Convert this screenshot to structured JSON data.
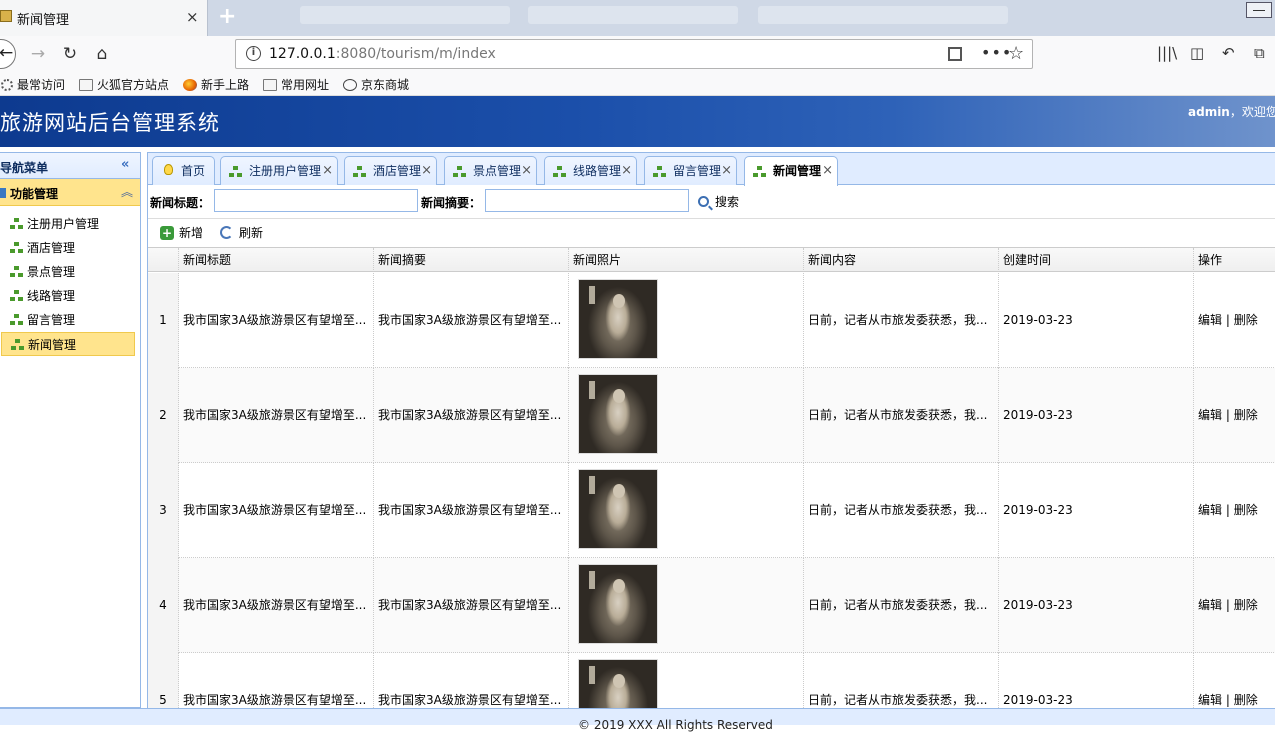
{
  "browser": {
    "tab_title": "新闻管理",
    "url_host": "127.0.0.1",
    "url_rest": ":8080/tourism/m/index",
    "bookmarks": [
      "最常访问",
      "火狐官方站点",
      "新手上路",
      "常用网址",
      "京东商城"
    ]
  },
  "app": {
    "title": "旅游网站后台管理系统",
    "user": "admin",
    "welcome": "，欢迎您"
  },
  "sidebar": {
    "title": "导航菜单",
    "section": "功能管理",
    "items": [
      {
        "label": "注册用户管理"
      },
      {
        "label": "酒店管理"
      },
      {
        "label": "景点管理"
      },
      {
        "label": "线路管理"
      },
      {
        "label": "留言管理"
      },
      {
        "label": "新闻管理"
      }
    ]
  },
  "tabs": [
    {
      "label": "首页"
    },
    {
      "label": "注册用户管理"
    },
    {
      "label": "酒店管理"
    },
    {
      "label": "景点管理"
    },
    {
      "label": "线路管理"
    },
    {
      "label": "留言管理"
    },
    {
      "label": "新闻管理"
    }
  ],
  "search": {
    "title_label": "新闻标题：",
    "summary_label": "新闻摘要：",
    "title_value": "",
    "summary_value": "",
    "button": "搜索"
  },
  "toolbar": {
    "add": "新增",
    "refresh": "刷新"
  },
  "grid": {
    "columns": [
      "新闻标题",
      "新闻摘要",
      "新闻照片",
      "新闻内容",
      "创建时间",
      "操作"
    ],
    "rows": [
      {
        "no": "1",
        "title": "我市国家3A级旅游景区有望增至...",
        "summary": "我市国家3A级旅游景区有望增至...",
        "content": "日前，记者从市旅发委获悉，我...",
        "created": "2019-03-23"
      },
      {
        "no": "2",
        "title": "我市国家3A级旅游景区有望增至...",
        "summary": "我市国家3A级旅游景区有望增至...",
        "content": "日前，记者从市旅发委获悉，我...",
        "created": "2019-03-23"
      },
      {
        "no": "3",
        "title": "我市国家3A级旅游景区有望增至...",
        "summary": "我市国家3A级旅游景区有望增至...",
        "content": "日前，记者从市旅发委获悉，我...",
        "created": "2019-03-23"
      },
      {
        "no": "4",
        "title": "我市国家3A级旅游景区有望增至...",
        "summary": "我市国家3A级旅游景区有望增至...",
        "content": "日前，记者从市旅发委获悉，我...",
        "created": "2019-03-23"
      },
      {
        "no": "5",
        "title": "我市国家3A级旅游景区有望增至...",
        "summary": "我市国家3A级旅游景区有望增至...",
        "content": "日前，记者从市旅发委获悉，我...",
        "created": "2019-03-23"
      }
    ],
    "edit_label": "编辑",
    "delete_label": "删除",
    "sep": "|"
  },
  "footer": {
    "text": "© 2019 XXX All Rights Reserved"
  }
}
